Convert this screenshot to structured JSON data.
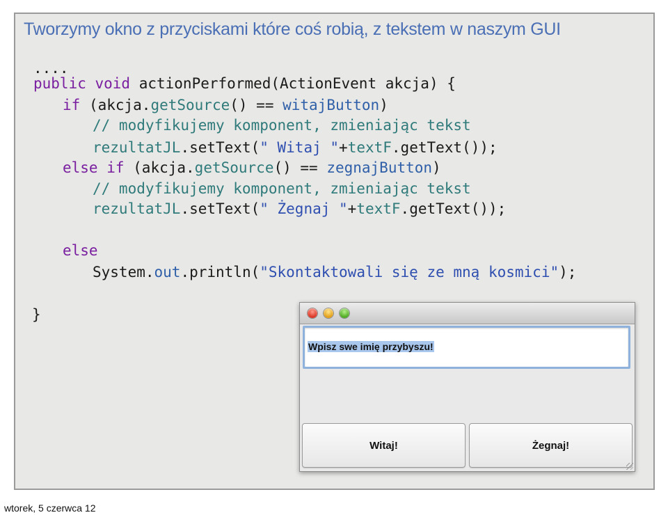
{
  "slide": {
    "title": "Tworzymy okno z przyciskami które coś robią, z tekstem w naszym GUI"
  },
  "code": {
    "l1": "....",
    "l2_kw": "public void",
    "l2_rest": " actionPerformed(ActionEvent akcja) {",
    "l3_kw": "if",
    "l3_a": " (akcja.",
    "l3_fn": "getSource",
    "l3_b": "() == ",
    "l3_var": "witajButton",
    "l3_c": ")",
    "l4_comment": "// modyfikujemy komponent, zmieniając tekst",
    "l5_fld": "rezultatJL",
    "l5_a": ".setText(",
    "l5_str": "\" Witaj \"",
    "l5_b": "+",
    "l5_fld2": "textF",
    "l5_c": ".getText());",
    "l6_kw": "else if",
    "l6_a": " (akcja.",
    "l6_fn": "getSource",
    "l6_b": "() == ",
    "l6_var": "zegnajButton",
    "l6_c": ")",
    "l7_comment": "// modyfikujemy komponent, zmieniając tekst",
    "l8_fld": "rezultatJL",
    "l8_a": ".setText(",
    "l8_str": "\" Żegnaj \"",
    "l8_b": "+",
    "l8_fld2": "textF",
    "l8_c": ".getText());",
    "l9_kw": "else",
    "l10_a": "System.",
    "l10_out": "out",
    "l10_b": ".println(",
    "l10_str": "\"Skontaktowali się ze mną kosmici\"",
    "l10_c": ");",
    "l11": "}"
  },
  "window": {
    "text_field_value": "Wpisz swe imię przybyszu!",
    "witaj_button_label": "Witaj!",
    "zegnaj_button_label": "Żegnaj!"
  },
  "footer": {
    "date": "wtorek, 5 czerwca 12"
  }
}
